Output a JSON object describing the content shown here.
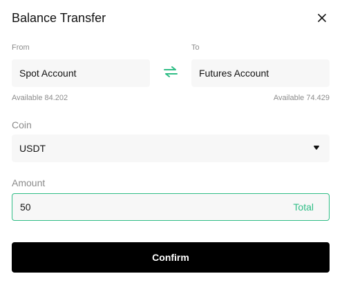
{
  "dialog": {
    "title": "Balance Transfer"
  },
  "transfer": {
    "from_label": "From",
    "to_label": "To",
    "from_account": "Spot Account",
    "to_account": "Futures Account",
    "from_available": "Available 84.202",
    "to_available": "Available 74.429"
  },
  "coin": {
    "label": "Coin",
    "selected": "USDT"
  },
  "amount": {
    "label": "Amount",
    "value": "50",
    "total_label": "Total"
  },
  "actions": {
    "confirm_label": "Confirm"
  },
  "colors": {
    "accent": "#2ebd85",
    "primary_button": "#000000",
    "field_background": "#f7f7f7"
  },
  "icons": {
    "close": "close-icon",
    "swap": "swap-arrows-icon",
    "dropdown": "caret-down-icon"
  }
}
